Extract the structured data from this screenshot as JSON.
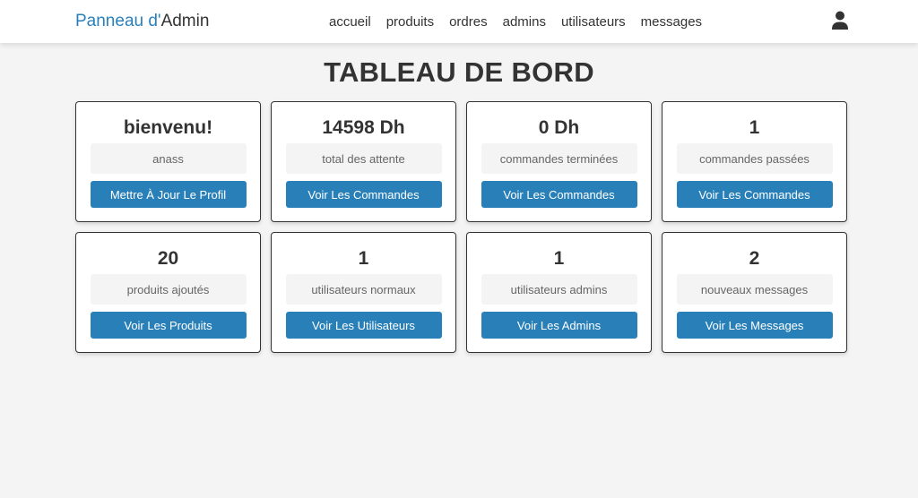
{
  "header": {
    "logo_prefix": "Panneau ",
    "logo_accent": "d'",
    "logo_suffix": "Admin",
    "nav": [
      "accueil",
      "produits",
      "ordres",
      "admins",
      "utilisateurs",
      "messages"
    ],
    "user_icon": "user-icon"
  },
  "page_title": "TABLEAU DE BORD",
  "cards": [
    {
      "value": "bienvenu!",
      "label": "anass",
      "button": "Mettre À Jour Le Profil"
    },
    {
      "value": "14598 Dh",
      "label": "total des attente",
      "button": "Voir Les Commandes"
    },
    {
      "value": "0 Dh",
      "label": "commandes terminées",
      "button": "Voir Les Commandes"
    },
    {
      "value": "1",
      "label": "commandes passées",
      "button": "Voir Les Commandes"
    },
    {
      "value": "20",
      "label": "produits ajoutés",
      "button": "Voir Les Produits"
    },
    {
      "value": "1",
      "label": "utilisateurs normaux",
      "button": "Voir Les Utilisateurs"
    },
    {
      "value": "1",
      "label": "utilisateurs admins",
      "button": "Voir Les Admins"
    },
    {
      "value": "2",
      "label": "nouveaux messages",
      "button": "Voir Les Messages"
    }
  ],
  "colors": {
    "accent": "#2980b9",
    "text": "#333333",
    "background": "#f4f4f4"
  }
}
